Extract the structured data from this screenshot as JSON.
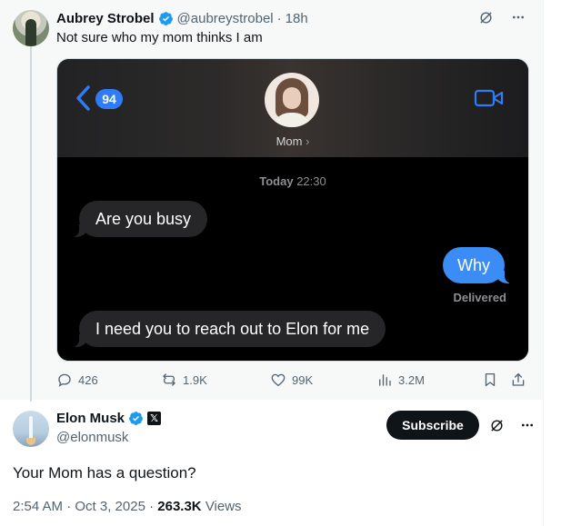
{
  "parent_tweet": {
    "author_name": "Aubrey Strobel",
    "handle": "@aubreystrobel",
    "separator": "·",
    "time": "18h",
    "text": "Not sure who my mom thinks I am",
    "media": {
      "unread_count": "94",
      "contact_name": "Mom",
      "contact_chevron": "›",
      "date_label": "Today",
      "time_label": "22:30",
      "messages": [
        {
          "from": "them",
          "text": "Are you busy"
        },
        {
          "from": "me",
          "text": "Why"
        },
        {
          "from": "them",
          "text": "I need you to reach out to Elon for me"
        }
      ],
      "status": "Delivered"
    },
    "stats": {
      "replies": "426",
      "reposts": "1.9K",
      "likes": "99K",
      "views": "3.2M"
    }
  },
  "main_tweet": {
    "author_name": "Elon Musk",
    "handle": "@elonmusk",
    "subscribe_label": "Subscribe",
    "text": "Your Mom has a question?",
    "timestamp": "2:54 AM · Oct 3, 2025",
    "separator": "·",
    "views_count": "263.3K",
    "views_label": "Views"
  },
  "colors": {
    "verified_blue": "#1d9bf0",
    "imessage_blue": "#3b8cf5",
    "text_secondary": "#536471"
  },
  "icons": [
    "verified-icon",
    "grok-icon",
    "more-icon",
    "reply-icon",
    "repost-icon",
    "like-icon",
    "views-icon",
    "bookmark-icon",
    "share-icon",
    "back-chevron-icon",
    "video-call-icon",
    "x-premium-icon"
  ]
}
